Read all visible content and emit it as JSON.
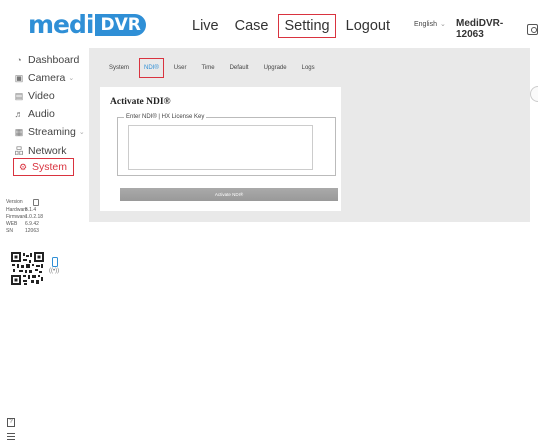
{
  "logo": {
    "medi": "medi",
    "dvr": "DVR"
  },
  "nav": {
    "items": [
      {
        "label": "Live",
        "active": false
      },
      {
        "label": "Case",
        "active": false
      },
      {
        "label": "Setting",
        "active": true
      },
      {
        "label": "Logout",
        "active": false
      }
    ]
  },
  "header": {
    "language": "English",
    "device_name": "MediDVR-12063"
  },
  "sidebar": {
    "items": [
      {
        "label": "Dashboard",
        "icon": "dashboard-icon"
      },
      {
        "label": "Camera",
        "icon": "camera-icon",
        "expandable": true
      },
      {
        "label": "Video",
        "icon": "video-icon"
      },
      {
        "label": "Audio",
        "icon": "audio-icon"
      },
      {
        "label": "Streaming",
        "icon": "streaming-icon",
        "expandable": true
      },
      {
        "label": "Network",
        "icon": "network-icon"
      },
      {
        "label": "System",
        "icon": "system-icon",
        "active": true
      }
    ],
    "version": {
      "title": "Version",
      "rows": [
        {
          "key": "Hardware",
          "value": "5.1.4"
        },
        {
          "key": "Firmware",
          "value": "1.0.2.18"
        },
        {
          "key": "WEB",
          "value": "6.9.42"
        },
        {
          "key": "SN",
          "value": "12063"
        }
      ]
    }
  },
  "tabs": [
    {
      "label": "System",
      "active": false
    },
    {
      "label": "NDI®",
      "active": true
    },
    {
      "label": "User",
      "active": false
    },
    {
      "label": "Time",
      "active": false
    },
    {
      "label": "Default",
      "active": false
    },
    {
      "label": "Upgrade",
      "active": false
    },
    {
      "label": "Logs",
      "active": false
    }
  ],
  "ndi": {
    "title": "Activate NDI®",
    "legend": "Enter NDI® | HX License Key",
    "key_value": "",
    "button_label": "Activate NDI®"
  },
  "colors": {
    "accent": "#2f8fd6",
    "active_border": "#d9333f",
    "panel_bg": "#e9e9e9",
    "button_bg": "#a3a3a3"
  }
}
